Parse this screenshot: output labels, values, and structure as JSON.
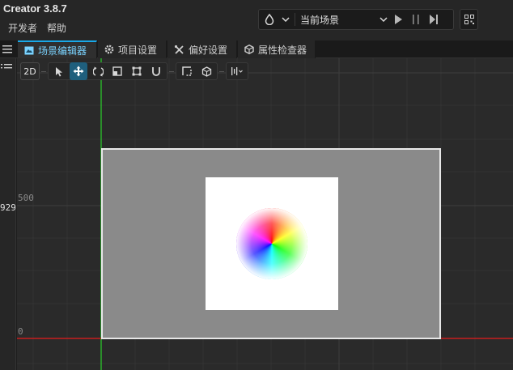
{
  "app": {
    "title": "Creator 3.8.7"
  },
  "menu": {
    "items": [
      "开发者",
      "帮助"
    ]
  },
  "toolbar": {
    "scene_label": "当前场景",
    "icons": [
      "drop-icon",
      "chevron-down-icon",
      "play-icon",
      "pause-icon",
      "step-icon",
      "qr-icon"
    ]
  },
  "tabs": [
    {
      "label": "场景编辑器",
      "icon": "scene-editor-icon",
      "active": true
    },
    {
      "label": "项目设置",
      "icon": "gear-icon",
      "active": false
    },
    {
      "label": "偏好设置",
      "icon": "tools-icon",
      "active": false
    },
    {
      "label": "属性检查器",
      "icon": "cube-icon",
      "active": false
    }
  ],
  "scene_tools": {
    "mode_label": "2D",
    "icons": [
      "select-icon",
      "move-icon",
      "rotate-icon",
      "scale-icon",
      "rect-icon",
      "snap-icon",
      "transform-space-icon",
      "pivot-icon",
      "align-icon"
    ]
  },
  "rulers": {
    "left_value": "929",
    "y_label_500": "500",
    "y_label_0": "0"
  },
  "colors": {
    "accent": "#19a8e8",
    "x_axis": "#c81e1e",
    "y_axis": "#2bd12b",
    "canvas": "#8a8a8a"
  }
}
